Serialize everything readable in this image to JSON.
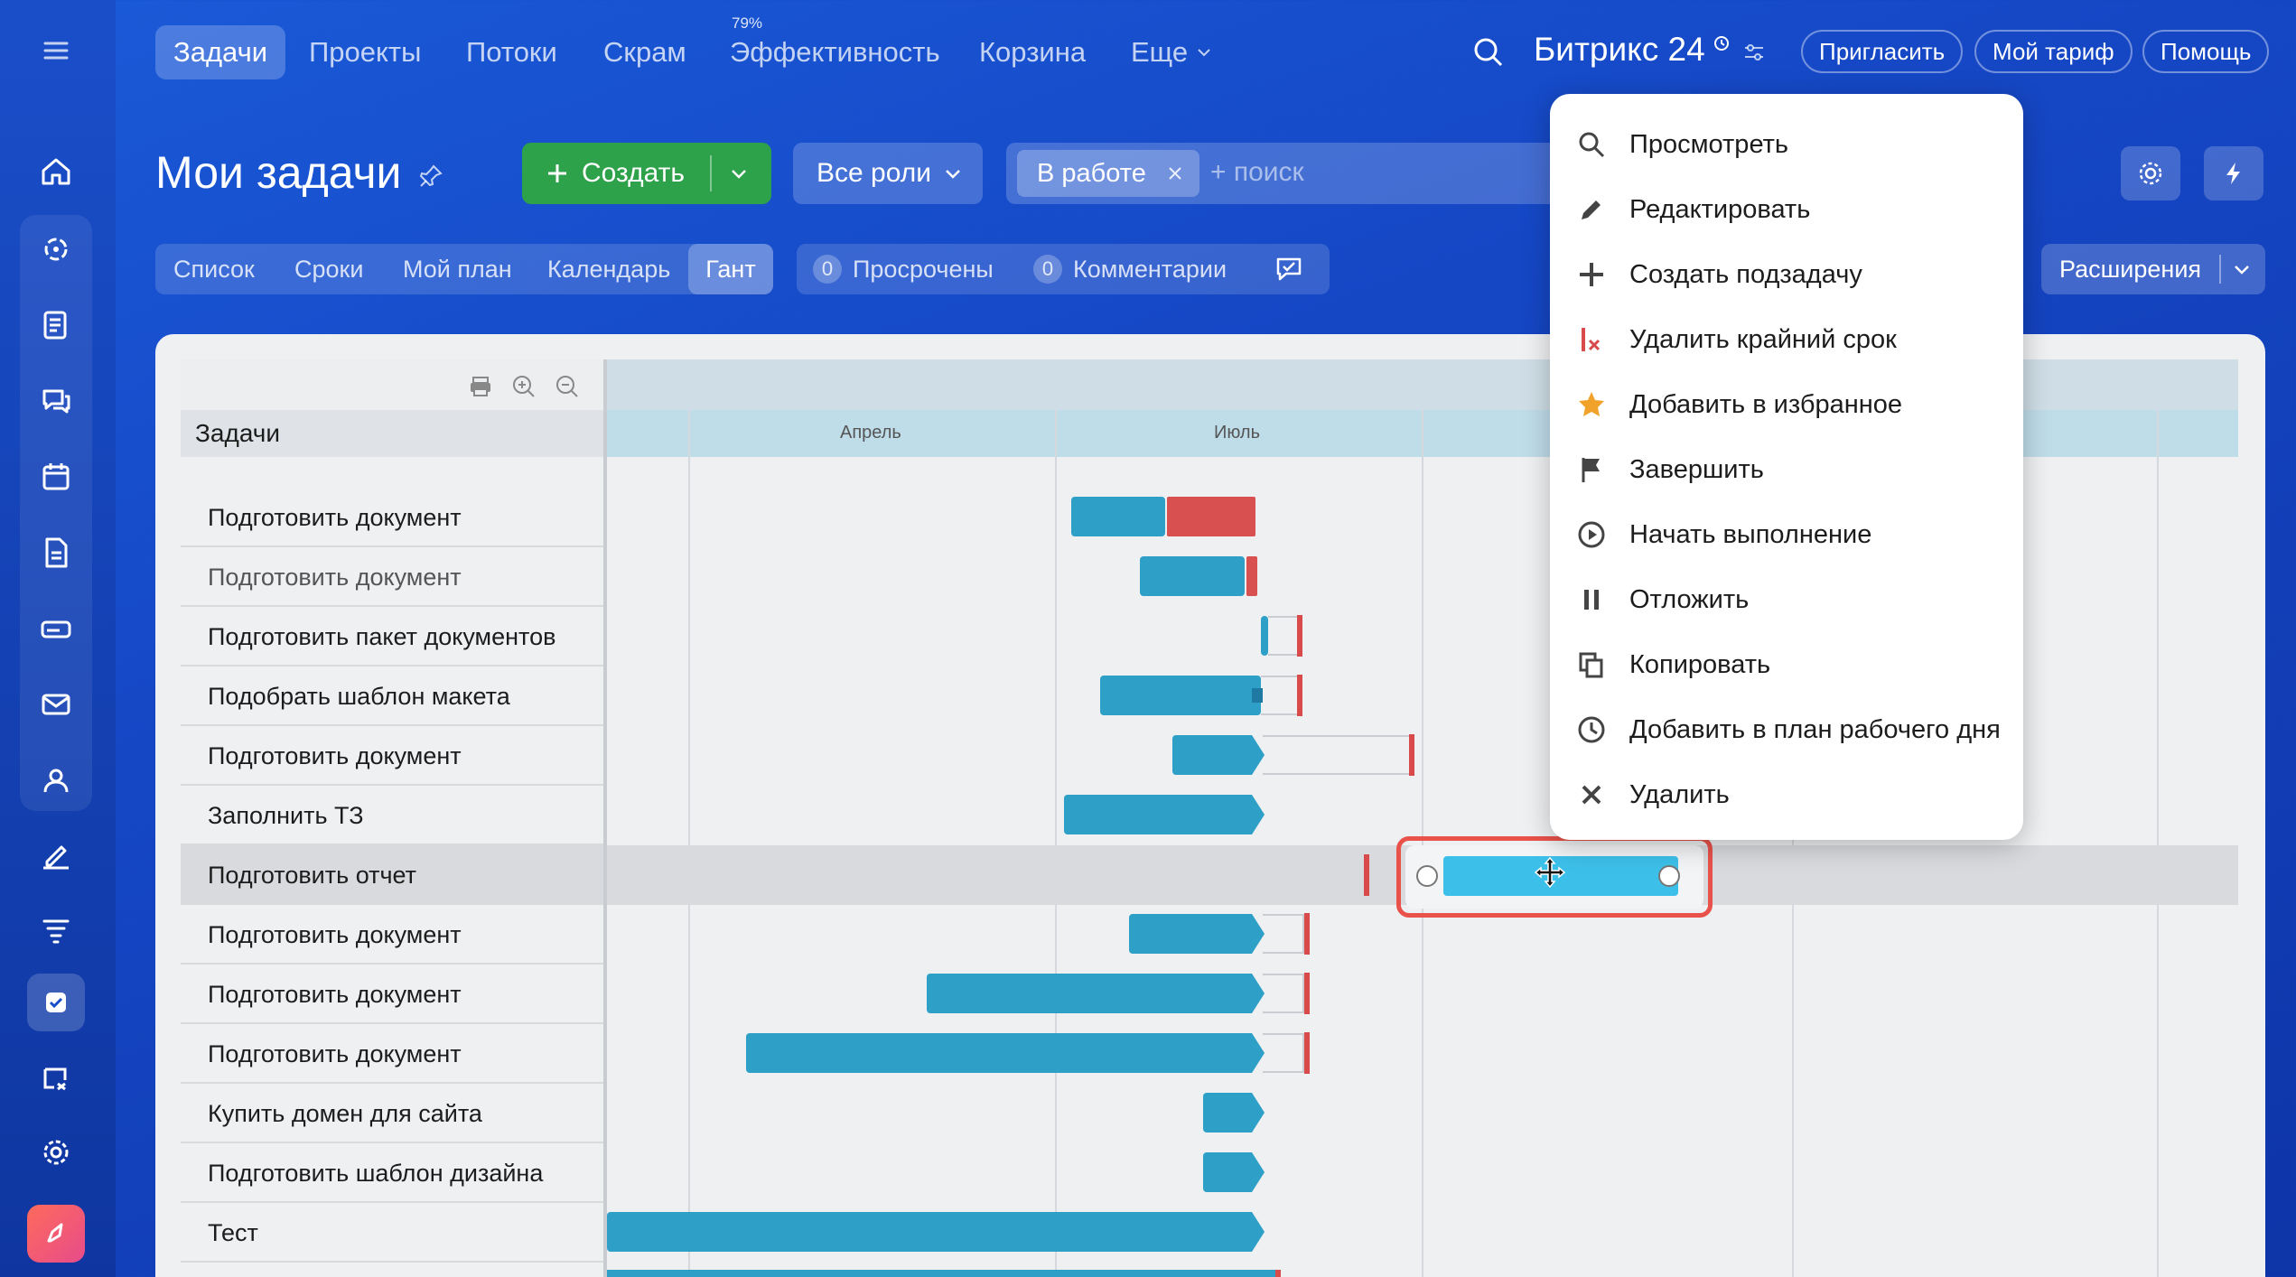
{
  "topnav": {
    "items": [
      "Задачи",
      "Проекты",
      "Потоки",
      "Скрам",
      "Эффективность",
      "Корзина",
      "Еще"
    ],
    "efficiency_badge": "79%",
    "brand": "Битрикс 24",
    "invite": "Пригласить",
    "tariff": "Мой тариф",
    "help": "Помощь"
  },
  "header": {
    "title": "Мои задачи",
    "create": "Создать",
    "roles": "Все роли",
    "filter_tag": "В работе",
    "search_placeholder": "+ поиск"
  },
  "views": {
    "tabs": [
      "Список",
      "Сроки",
      "Мой план",
      "Календарь",
      "Гант"
    ],
    "overdue_count": "0",
    "overdue_label": "Просрочены",
    "comments_count": "0",
    "comments_label": "Комментарии",
    "extensions": "Расширения"
  },
  "gantt": {
    "tasks_header": "Задачи",
    "months": [
      "Апрель",
      "Июль"
    ],
    "tasks": [
      "Подготовить документ",
      "Подготовить документ",
      "Подготовить пакет документов",
      "Подобрать шаблон макета",
      "Подготовить документ",
      "Заполнить ТЗ",
      "Подготовить отчет",
      "Подготовить документ",
      "Подготовить документ",
      "Подготовить документ",
      "Купить домен для сайта",
      "Подготовить шаблон дизайна",
      "Тест"
    ]
  },
  "context_menu": {
    "items": [
      {
        "label": "Просмотреть",
        "icon": "search-icon"
      },
      {
        "label": "Редактировать",
        "icon": "pencil-icon"
      },
      {
        "label": "Создать подзадачу",
        "icon": "plus-icon"
      },
      {
        "label": "Удалить крайний срок",
        "icon": "remove-deadline-icon"
      },
      {
        "label": "Добавить в избранное",
        "icon": "star-icon"
      },
      {
        "label": "Завершить",
        "icon": "flag-icon"
      },
      {
        "label": "Начать выполнение",
        "icon": "play-icon"
      },
      {
        "label": "Отложить",
        "icon": "pause-icon"
      },
      {
        "label": "Копировать",
        "icon": "copy-icon"
      },
      {
        "label": "Добавить в план рабочего дня",
        "icon": "clock-icon"
      },
      {
        "label": "Удалить",
        "icon": "close-icon"
      }
    ]
  },
  "colors": {
    "bar": "#2e9fc7",
    "bar_selected": "#3cc0ea",
    "deadline": "#d94b4b",
    "create_button": "#2ea24a",
    "highlight_border": "#e8524a",
    "star": "#f0a22a"
  }
}
